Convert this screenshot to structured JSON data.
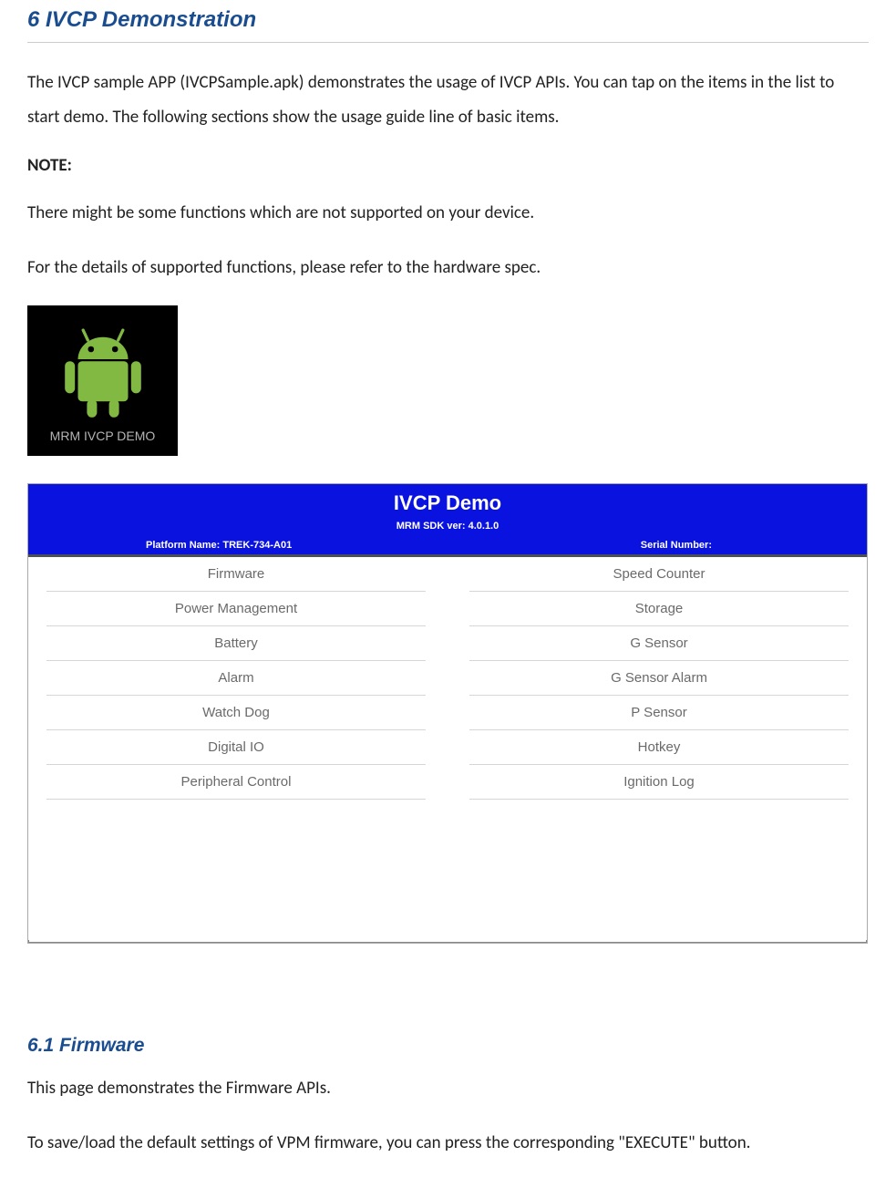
{
  "section": {
    "heading": "6 IVCP Demonstration",
    "p1": "The IVCP sample APP (IVCPSample.apk) demonstrates the usage of IVCP APIs. You can tap on the items in the list to start demo. The following sections show the usage guide line of basic items.",
    "note_label": "NOTE:",
    "p2": "There might be some functions which are not supported on your device.",
    "p3": "For the details of supported functions, please refer to the hardware spec."
  },
  "app_icon": {
    "caption": "MRM IVCP DEMO"
  },
  "demo": {
    "title": "IVCP Demo",
    "subtitle": "MRM SDK ver:  4.0.1.0",
    "platform_label": "Platform Name:",
    "platform_value": " TREK-734-A01",
    "serial_label": "Serial Number:",
    "serial_value": "",
    "left_items": [
      "Firmware",
      "Power Management",
      "Battery",
      "Alarm",
      "Watch Dog",
      "Digital IO",
      "Peripheral Control"
    ],
    "right_items": [
      "Speed Counter",
      "Storage",
      "G Sensor",
      "G Sensor Alarm",
      "P Sensor",
      "Hotkey",
      "Ignition Log"
    ]
  },
  "subsection": {
    "heading": "6.1 Firmware",
    "p1": "This page demonstrates the Firmware APIs.",
    "p2": "To save/load the default settings of VPM firmware, you can press the corresponding \"EXECUTE\" button."
  }
}
